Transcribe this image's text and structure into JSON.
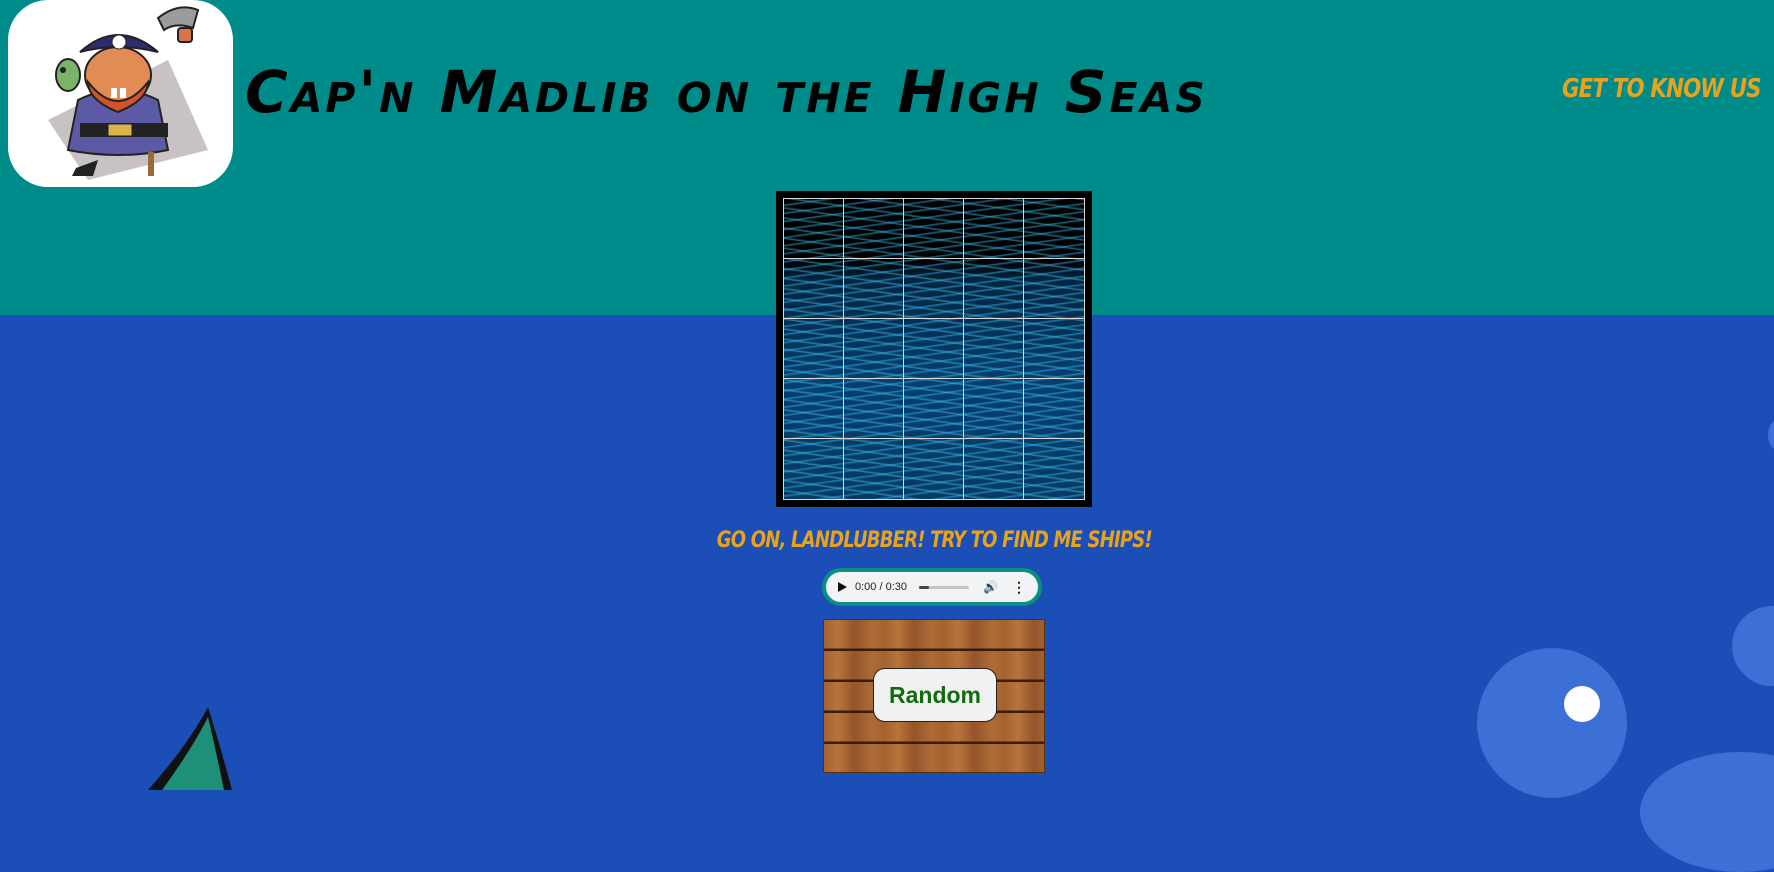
{
  "header": {
    "title": "Cap'n Madlib on the High Seas",
    "nav_link": "Get to Know Us",
    "logo_icon": "pirate-captain-logo"
  },
  "colors": {
    "sky": "#008b8b",
    "sea": "#1b4eb6",
    "accent": "#e8a21c",
    "button_text": "#116b11",
    "audio_border": "#0b8f80"
  },
  "board": {
    "rows": 5,
    "columns": 5,
    "background": "ocean-waves"
  },
  "prompt": "Go on, landlubber! Try to find me ships!",
  "audio": {
    "time": "0:00 / 0:30",
    "progress": 0.0
  },
  "random_button": "Random",
  "decorations": [
    "shark-fin-icon",
    "bubble-icon"
  ]
}
